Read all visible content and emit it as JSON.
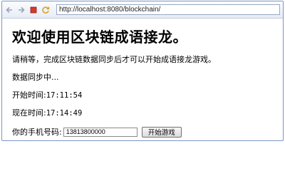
{
  "browser": {
    "url": "http://localhost:8080/blockchain/"
  },
  "page": {
    "heading": "欢迎使用区块链成语接龙。",
    "notice": "请稍等，完成区块链数据同步后才可以开始成语接龙游戏。",
    "sync_status": "数据同步中...",
    "start_time_label": "开始时间:",
    "start_time": "17:11:54",
    "current_time_label": "现在时间:",
    "current_time": "17:14:49",
    "phone_label": "你的手机号码:",
    "phone_value": "13813800000",
    "start_button": "开始游戏"
  }
}
